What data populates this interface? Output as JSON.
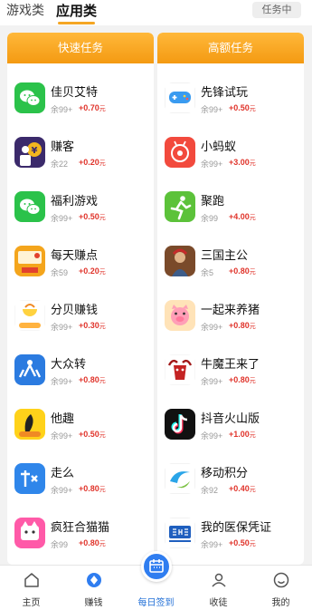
{
  "header": {
    "tabs": [
      {
        "label": "游戏类"
      },
      {
        "label": "应用类"
      }
    ],
    "task_pill": "任务中"
  },
  "columns": [
    {
      "title": "快速任务",
      "tasks": [
        {
          "name": "佳贝艾特",
          "remain": "余99+",
          "reward": "+0.70",
          "unit": "元",
          "icon": "wechat-icon"
        },
        {
          "name": "赚客",
          "remain": "余22",
          "reward": "+0.20",
          "unit": "元",
          "icon": "zhuanke-icon"
        },
        {
          "name": "福利游戏",
          "remain": "余99+",
          "reward": "+0.50",
          "unit": "元",
          "icon": "wechat-icon"
        },
        {
          "name": "每天赚点",
          "remain": "余59",
          "reward": "+0.20",
          "unit": "元",
          "icon": "make-money-icon"
        },
        {
          "name": "分贝赚钱",
          "remain": "余99+",
          "reward": "+0.30",
          "unit": "元",
          "icon": "fenbei-icon"
        },
        {
          "name": "大众转",
          "remain": "余99+",
          "reward": "+0.80",
          "unit": "元",
          "icon": "dazhongzhuan-icon"
        },
        {
          "name": "他趣",
          "remain": "余99+",
          "reward": "+0.50",
          "unit": "元",
          "icon": "taqu-icon"
        },
        {
          "name": "走么",
          "remain": "余99+",
          "reward": "+0.80",
          "unit": "元",
          "icon": "zoume-icon"
        },
        {
          "name": "疯狂合猫猫",
          "remain": "余99",
          "reward": "+0.80",
          "unit": "元",
          "icon": "cat-game-icon"
        }
      ]
    },
    {
      "title": "高额任务",
      "tasks": [
        {
          "name": "先锋试玩",
          "remain": "余99+",
          "reward": "+0.50",
          "unit": "元",
          "icon": "gamepad-icon"
        },
        {
          "name": "小蚂蚁",
          "remain": "余99+",
          "reward": "+3.00",
          "unit": "元",
          "icon": "ant-icon"
        },
        {
          "name": "聚跑",
          "remain": "余99",
          "reward": "+4.00",
          "unit": "元",
          "icon": "runner-icon"
        },
        {
          "name": "三国主公",
          "remain": "余5",
          "reward": "+0.80",
          "unit": "元",
          "icon": "warrior-icon"
        },
        {
          "name": "一起来养猪",
          "remain": "余99+",
          "reward": "+0.80",
          "unit": "元",
          "icon": "pig-icon"
        },
        {
          "name": "牛魔王来了",
          "remain": "余99+",
          "reward": "+0.80",
          "unit": "元",
          "icon": "bull-king-icon"
        },
        {
          "name": "抖音火山版",
          "remain": "余99+",
          "reward": "+1.00",
          "unit": "元",
          "icon": "douyin-icon"
        },
        {
          "name": "移动积分",
          "remain": "余92",
          "reward": "+0.40",
          "unit": "元",
          "icon": "china-mobile-icon"
        },
        {
          "name": "我的医保凭证",
          "remain": "余99+",
          "reward": "+0.50",
          "unit": "元",
          "icon": "chs-icon"
        }
      ]
    }
  ],
  "bottom_nav": [
    {
      "label": "主页",
      "icon": "home-icon"
    },
    {
      "label": "赚钱",
      "icon": "earn-icon"
    },
    {
      "label": "每日签到",
      "icon": "calendar-icon"
    },
    {
      "label": "收徒",
      "icon": "apprentice-icon"
    },
    {
      "label": "我的",
      "icon": "profile-icon"
    }
  ],
  "colors": {
    "accent": "#f5a623",
    "reward": "#e0342b",
    "nav_active": "#1f6ed6"
  }
}
